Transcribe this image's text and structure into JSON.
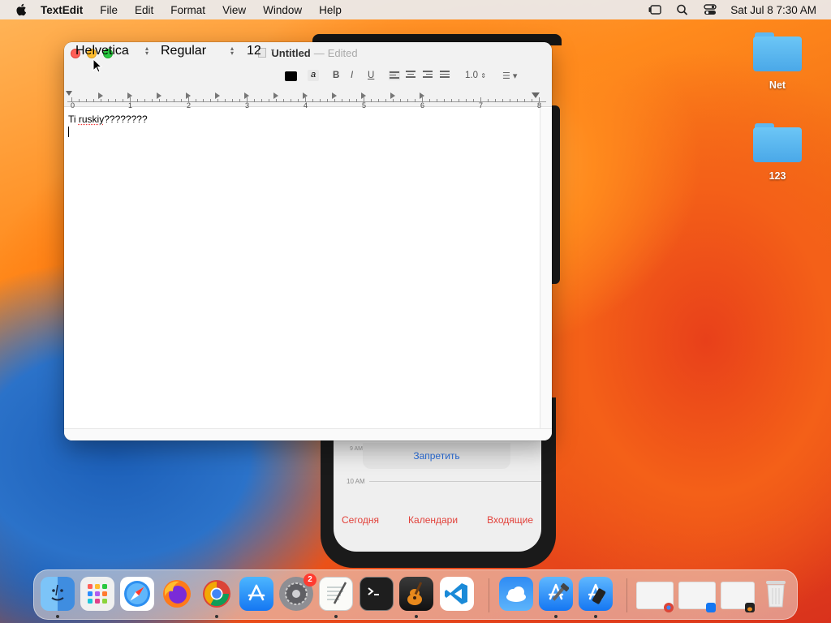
{
  "menubar": {
    "app_name": "TextEdit",
    "items": [
      "File",
      "Edit",
      "Format",
      "View",
      "Window",
      "Help"
    ],
    "datetime": "Sat Jul 8  7:30 AM"
  },
  "desktop": {
    "icons": [
      {
        "label": "Net",
        "icon": "folder-icon"
      },
      {
        "label": "123",
        "icon": "folder-icon"
      }
    ]
  },
  "phone": {
    "popup_button": "Запретить",
    "time_label_8": "9 AM",
    "time_label_10": "10 AM",
    "tabs": [
      "Сегодня",
      "Календари",
      "Входящие"
    ]
  },
  "window": {
    "title": "Untitled",
    "title_separator": "—",
    "status": "Edited",
    "toolbar": {
      "font": "Helvetica",
      "style": "Regular",
      "size": "12",
      "bold": "B",
      "italic": "I",
      "underline": "U",
      "line_spacing": "1.0",
      "highlight": "a"
    },
    "ruler_numbers": [
      "0",
      "1",
      "2",
      "3",
      "4",
      "5",
      "6",
      "7",
      "8"
    ],
    "document": {
      "text_before": "Ti ",
      "misspelled_word": "ruskiy",
      "text_after": "????????"
    }
  },
  "dock": {
    "apps": [
      {
        "name": "Finder",
        "icon": "finder-icon",
        "running": true
      },
      {
        "name": "Launchpad",
        "icon": "launchpad-icon",
        "running": false
      },
      {
        "name": "Safari",
        "icon": "safari-icon",
        "running": false
      },
      {
        "name": "Firefox",
        "icon": "firefox-icon",
        "running": false
      },
      {
        "name": "Chrome",
        "icon": "chrome-icon",
        "running": true
      },
      {
        "name": "App Store",
        "icon": "app-store-icon",
        "running": false
      },
      {
        "name": "System Settings",
        "icon": "settings-icon",
        "running": false,
        "badge": "2"
      },
      {
        "name": "TextEdit",
        "icon": "textedit-icon",
        "running": true
      },
      {
        "name": "Terminal",
        "icon": "terminal-icon",
        "running": false
      },
      {
        "name": "GarageBand",
        "icon": "garageband-icon",
        "running": true
      },
      {
        "name": "VS Code",
        "icon": "vscode-icon",
        "running": false
      },
      {
        "name": "Weather",
        "icon": "weather-icon",
        "running": false
      },
      {
        "name": "Xcode",
        "icon": "xcode-icon",
        "running": true
      },
      {
        "name": "Simulator",
        "icon": "simulator-icon",
        "running": true
      }
    ]
  },
  "colors": {
    "accent": "#2a6edb",
    "close": "#ff5f57",
    "minimize": "#febc2e",
    "zoom": "#28c840"
  }
}
